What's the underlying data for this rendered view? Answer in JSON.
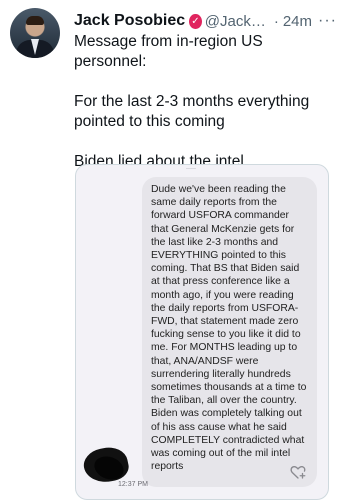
{
  "tweet": {
    "author_name": "Jack Posobiec",
    "verified_glyph": "✓",
    "handle": "@Jack…",
    "dot": "·",
    "time": "24m",
    "more": "···",
    "paragraphs": [
      "Message from in-region US personnel:",
      "For the last 2-3 months everything pointed to this coming",
      "Biden lied about the intel"
    ]
  },
  "media": {
    "message_text": "Dude we've been reading the same daily reports from the forward USFORA commander that General McKenzie gets for the last like 2-3 months and EVERYTHING pointed to this coming. That BS that Biden said at that press conference like a month ago, if you were reading the daily reports from USFORA-FWD, that statement made zero fucking sense to you like it did to me. For MONTHS leading up to that, ANA/ANDSF were surrendering literally hundreds sometimes thousands at a time to the Taliban, all over the country. Biden was completely talking out of his ass cause what he said COMPLETELY contradicted what was coming out of the mil intel reports",
    "message_time": "12:37 PM",
    "react_icon": "heart-plus-icon"
  },
  "colors": {
    "secondary_text": "#536471",
    "badge": "#e0245e",
    "bubble": "#e6e5ea"
  }
}
